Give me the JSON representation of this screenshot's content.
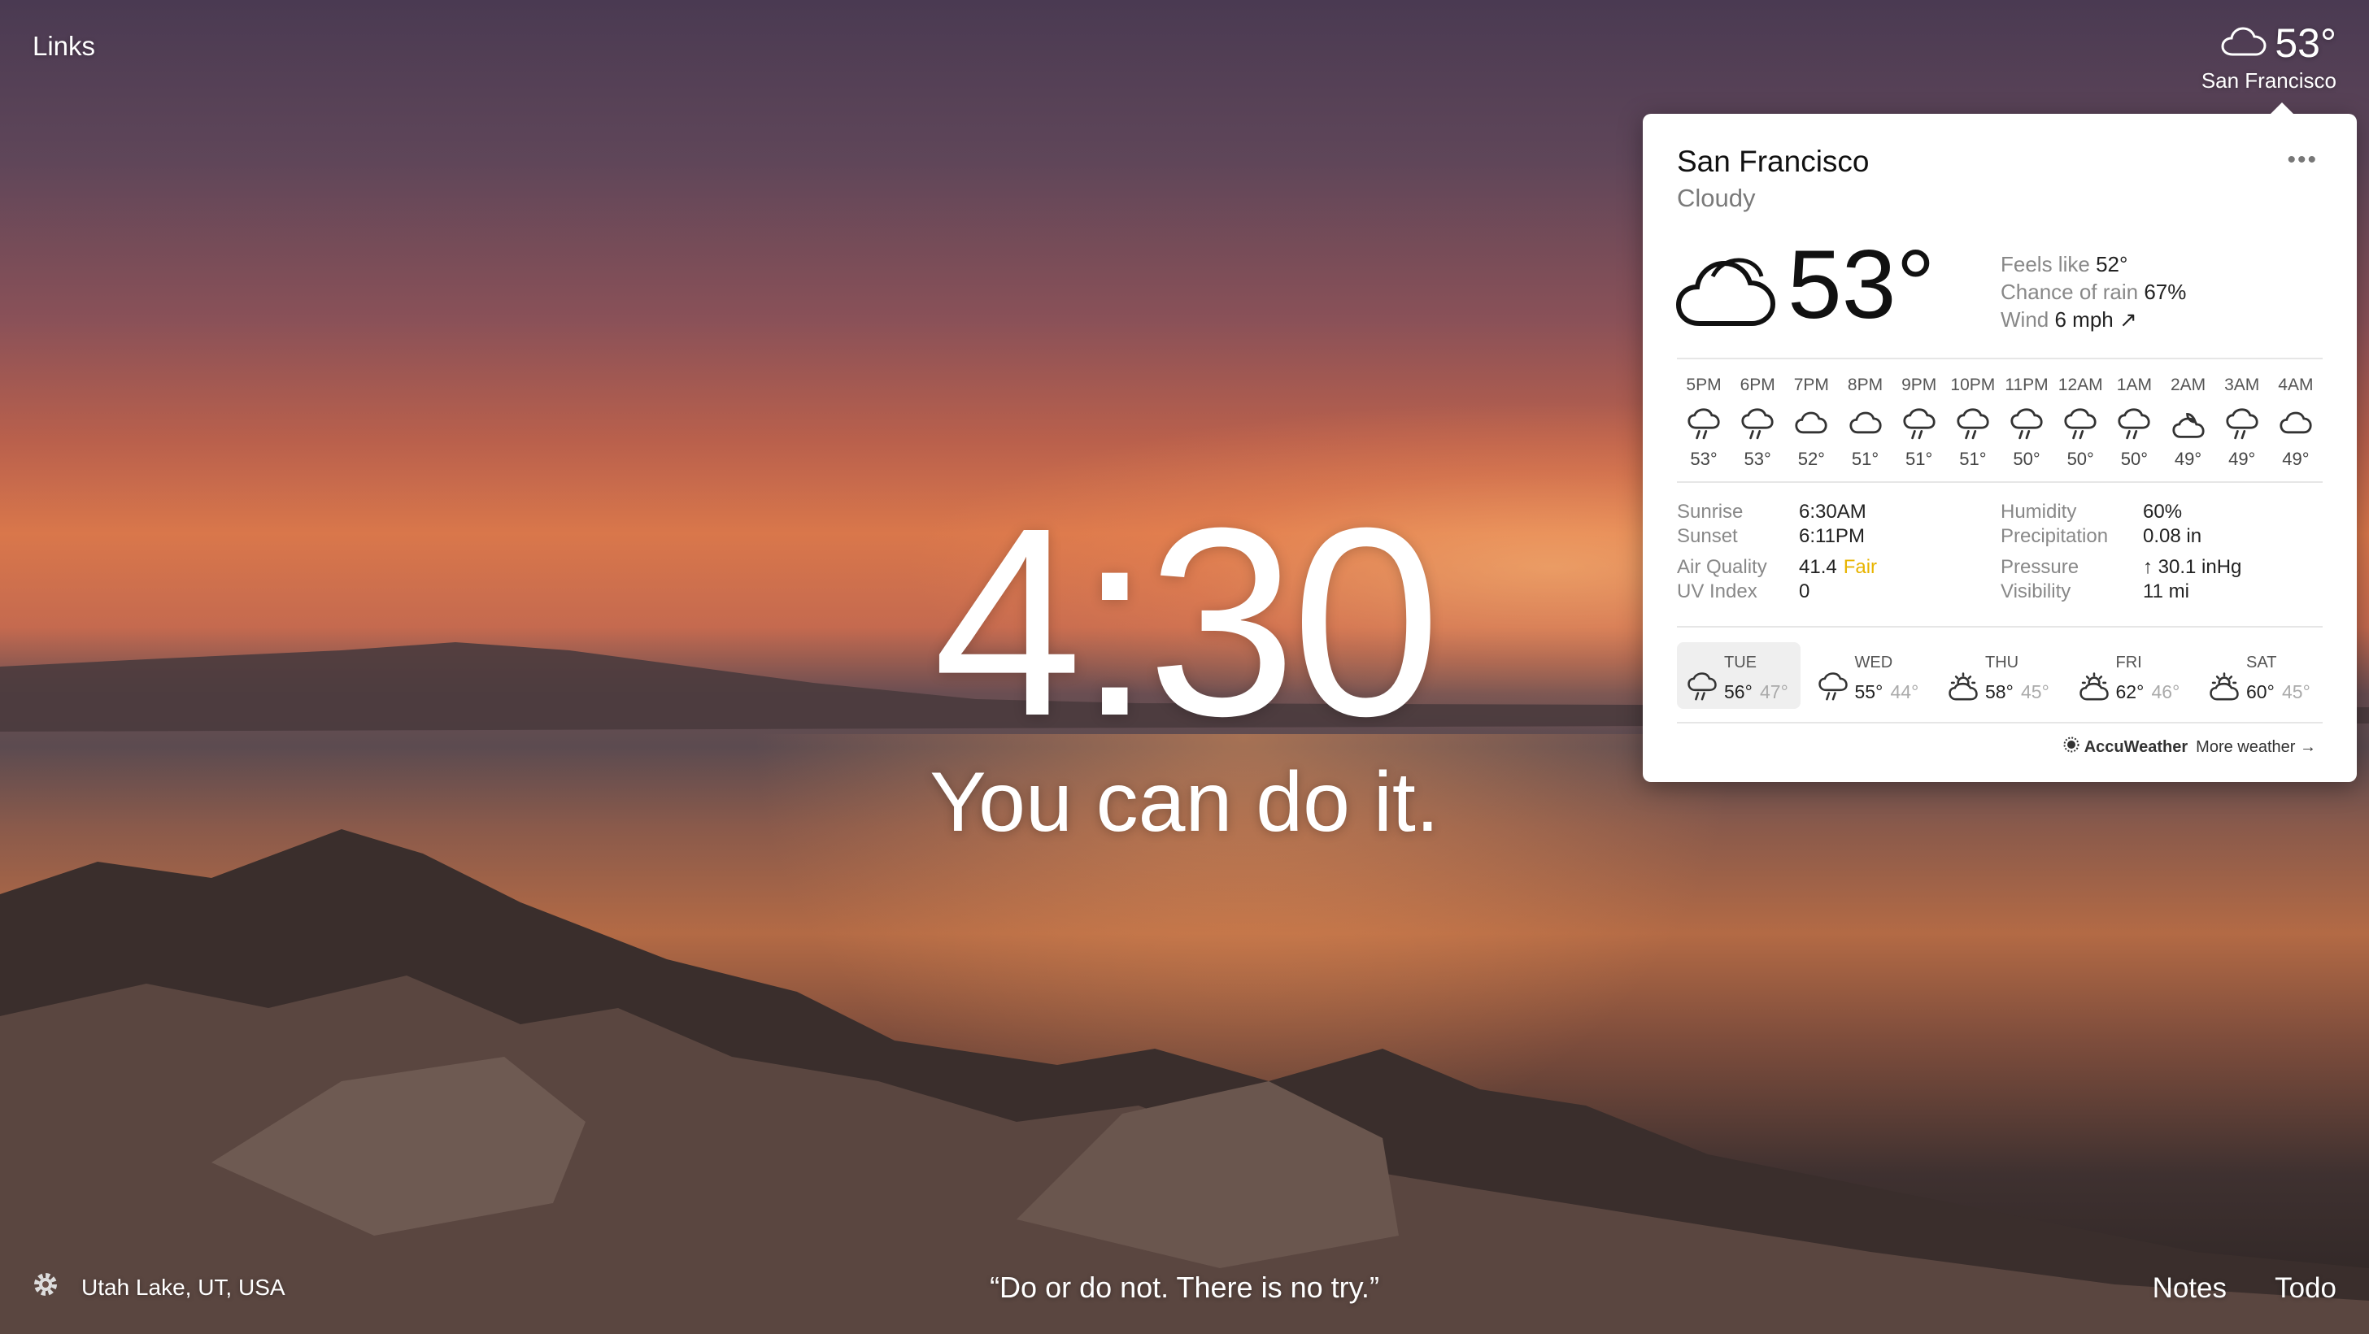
{
  "header": {
    "links_label": "Links"
  },
  "top_weather": {
    "temp": "53°",
    "city": "San Francisco",
    "icon": "cloud-icon"
  },
  "clock": {
    "time": "4:30"
  },
  "mantra": {
    "text": "You can do it."
  },
  "footer": {
    "location": "Utah Lake, UT, USA",
    "quote": "“Do or do not. There is no try.”",
    "notes_label": "Notes",
    "todo_label": "Todo"
  },
  "weather_panel": {
    "city": "San Francisco",
    "condition": "Cloudy",
    "temp": "53°",
    "more_label": "•••",
    "details": [
      {
        "label": "Feels like",
        "value": "52°"
      },
      {
        "label": "Chance of rain",
        "value": "67%"
      },
      {
        "label": "Wind",
        "value": "6 mph ↗"
      }
    ],
    "hourly": [
      {
        "time": "5PM",
        "icon": "rain-icon",
        "temp": "53°"
      },
      {
        "time": "6PM",
        "icon": "rain-icon",
        "temp": "53°"
      },
      {
        "time": "7PM",
        "icon": "cloud-icon",
        "temp": "52°"
      },
      {
        "time": "8PM",
        "icon": "cloud-icon",
        "temp": "51°"
      },
      {
        "time": "9PM",
        "icon": "rain-icon",
        "temp": "51°"
      },
      {
        "time": "10PM",
        "icon": "rain-icon",
        "temp": "51°"
      },
      {
        "time": "11PM",
        "icon": "rain-icon",
        "temp": "50°"
      },
      {
        "time": "12AM",
        "icon": "rain-icon",
        "temp": "50°"
      },
      {
        "time": "1AM",
        "icon": "rain-icon",
        "temp": "50°"
      },
      {
        "time": "2AM",
        "icon": "partly-cloudy-night-icon",
        "temp": "49°"
      },
      {
        "time": "3AM",
        "icon": "rain-icon",
        "temp": "49°"
      },
      {
        "time": "4AM",
        "icon": "cloud-icon",
        "temp": "49°"
      }
    ],
    "stats": {
      "sunrise": {
        "label": "Sunrise",
        "value": "6:30AM"
      },
      "sunset": {
        "label": "Sunset",
        "value": "6:11PM"
      },
      "air_quality": {
        "label": "Air Quality",
        "value": "41.4",
        "rating": "Fair"
      },
      "uv_index": {
        "label": "UV Index",
        "value": "0"
      },
      "humidity": {
        "label": "Humidity",
        "value": "60%"
      },
      "precipitation": {
        "label": "Precipitation",
        "value": "0.08 in"
      },
      "pressure": {
        "label": "Pressure",
        "value": "↑ 30.1 inHg"
      },
      "visibility": {
        "label": "Visibility",
        "value": "11 mi"
      }
    },
    "daily": [
      {
        "day": "TUE",
        "icon": "rain-icon",
        "hi": "56°",
        "lo": "47°",
        "selected": true
      },
      {
        "day": "WED",
        "icon": "rain-icon",
        "hi": "55°",
        "lo": "44°",
        "selected": false
      },
      {
        "day": "THU",
        "icon": "partly-sunny-icon",
        "hi": "58°",
        "lo": "45°",
        "selected": false
      },
      {
        "day": "FRI",
        "icon": "partly-sunny-icon",
        "hi": "62°",
        "lo": "46°",
        "selected": false
      },
      {
        "day": "SAT",
        "icon": "partly-sunny-icon",
        "hi": "60°",
        "lo": "45°",
        "selected": false
      }
    ],
    "provider": "AccuWeather",
    "more_weather": "More weather →"
  },
  "colors": {
    "panel_bg": "#ffffff",
    "fair": "#e8b400",
    "text_primary": "#222222",
    "text_muted": "#888888"
  }
}
